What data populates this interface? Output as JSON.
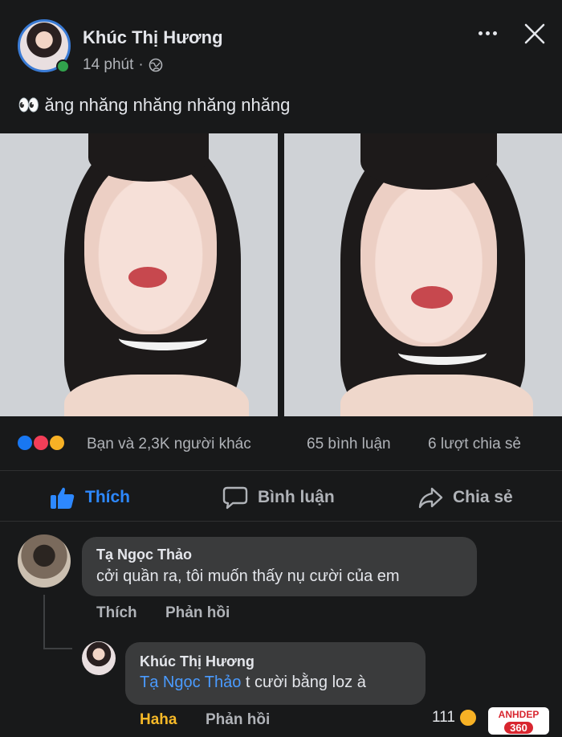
{
  "post": {
    "author": "Khúc Thị Hương",
    "time": "14 phút",
    "separator": "·",
    "privacy_icon": "globe-icon",
    "text_emoji": "👀",
    "text": "ăng nhăng nhăng nhăng nhăng"
  },
  "stats": {
    "reactions_text": "Bạn và 2,3K người khác",
    "comments": "65 bình luận",
    "shares": "6 lượt chia sẻ"
  },
  "actions": {
    "like": "Thích",
    "comment": "Bình luận",
    "share": "Chia sẻ"
  },
  "comments": [
    {
      "author": "Tạ Ngọc Thảo",
      "text": "cởi quần ra, tôi muốn thấy nụ cười của em",
      "like_label": "Thích",
      "reply_label": "Phản hồi"
    }
  ],
  "reply": {
    "author": "Khúc Thị Hương",
    "tag": "Tạ Ngọc Thảo",
    "text": " t cười bằng loz à",
    "reaction_label": "Haha",
    "reply_label": "Phản hồi",
    "reaction_count": "111"
  },
  "watermark": {
    "line1": "ANHDEP",
    "line2": "360"
  },
  "colors": {
    "background": "#18191a",
    "accent": "#2d88ff",
    "online": "#31a24c",
    "like_reaction": "#1877f2",
    "love_reaction": "#f33e58",
    "haha_reaction": "#f7b125",
    "reaction_text": "#f7b928"
  }
}
